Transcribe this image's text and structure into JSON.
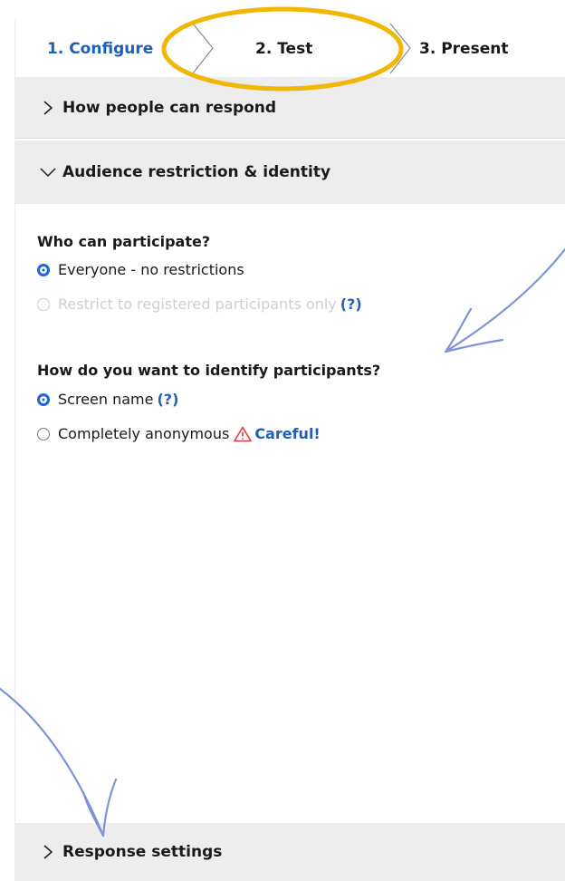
{
  "stepper": {
    "steps": [
      {
        "label": "1. Configure"
      },
      {
        "label": "2. Test"
      },
      {
        "label": "3. Present"
      }
    ]
  },
  "sections": {
    "respond": {
      "label": "How people can respond"
    },
    "audience": {
      "label": "Audience restriction & identity"
    },
    "response_settings": {
      "label": "Response settings"
    }
  },
  "participate": {
    "heading": "Who can participate?",
    "options": [
      {
        "label": "Everyone - no restrictions",
        "selected": true
      },
      {
        "label": "Restrict to registered participants only",
        "selected": false,
        "disabled": true,
        "help": "(?)"
      }
    ]
  },
  "identify": {
    "heading": "How do you want to identify participants?",
    "options": [
      {
        "label": "Screen name",
        "selected": true,
        "help": "(?)"
      },
      {
        "label": "Completely anonymous",
        "selected": false,
        "link": "Careful!"
      }
    ]
  },
  "colors": {
    "accent": "#1f5fb5",
    "radio": "#1f66d6",
    "highlight_ellipse": "#f2b705",
    "annotation_arrow": "#7f93d6",
    "warning": "#e03a3a",
    "section_bg": "#ededed"
  }
}
